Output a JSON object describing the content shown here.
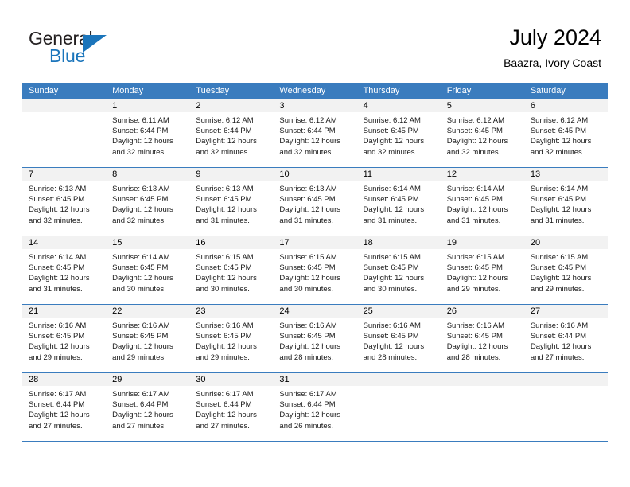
{
  "brand": {
    "word1": "General",
    "word2": "Blue",
    "accent_color": "#1b75bb",
    "logo_icon": "triangle-icon"
  },
  "header": {
    "title": "July 2024",
    "subtitle": "Baazra, Ivory Coast"
  },
  "calendar": {
    "header_bg": "#3a7cbe",
    "daynum_bg": "#f2f2f2",
    "weekday_names": [
      "Sunday",
      "Monday",
      "Tuesday",
      "Wednesday",
      "Thursday",
      "Friday",
      "Saturday"
    ],
    "weeks": [
      [
        null,
        {
          "day": "1",
          "sunrise": "Sunrise: 6:11 AM",
          "sunset": "Sunset: 6:44 PM",
          "daylight_line1": "Daylight: 12 hours",
          "daylight_line2": "and 32 minutes."
        },
        {
          "day": "2",
          "sunrise": "Sunrise: 6:12 AM",
          "sunset": "Sunset: 6:44 PM",
          "daylight_line1": "Daylight: 12 hours",
          "daylight_line2": "and 32 minutes."
        },
        {
          "day": "3",
          "sunrise": "Sunrise: 6:12 AM",
          "sunset": "Sunset: 6:44 PM",
          "daylight_line1": "Daylight: 12 hours",
          "daylight_line2": "and 32 minutes."
        },
        {
          "day": "4",
          "sunrise": "Sunrise: 6:12 AM",
          "sunset": "Sunset: 6:45 PM",
          "daylight_line1": "Daylight: 12 hours",
          "daylight_line2": "and 32 minutes."
        },
        {
          "day": "5",
          "sunrise": "Sunrise: 6:12 AM",
          "sunset": "Sunset: 6:45 PM",
          "daylight_line1": "Daylight: 12 hours",
          "daylight_line2": "and 32 minutes."
        },
        {
          "day": "6",
          "sunrise": "Sunrise: 6:12 AM",
          "sunset": "Sunset: 6:45 PM",
          "daylight_line1": "Daylight: 12 hours",
          "daylight_line2": "and 32 minutes."
        }
      ],
      [
        {
          "day": "7",
          "sunrise": "Sunrise: 6:13 AM",
          "sunset": "Sunset: 6:45 PM",
          "daylight_line1": "Daylight: 12 hours",
          "daylight_line2": "and 32 minutes."
        },
        {
          "day": "8",
          "sunrise": "Sunrise: 6:13 AM",
          "sunset": "Sunset: 6:45 PM",
          "daylight_line1": "Daylight: 12 hours",
          "daylight_line2": "and 32 minutes."
        },
        {
          "day": "9",
          "sunrise": "Sunrise: 6:13 AM",
          "sunset": "Sunset: 6:45 PM",
          "daylight_line1": "Daylight: 12 hours",
          "daylight_line2": "and 31 minutes."
        },
        {
          "day": "10",
          "sunrise": "Sunrise: 6:13 AM",
          "sunset": "Sunset: 6:45 PM",
          "daylight_line1": "Daylight: 12 hours",
          "daylight_line2": "and 31 minutes."
        },
        {
          "day": "11",
          "sunrise": "Sunrise: 6:14 AM",
          "sunset": "Sunset: 6:45 PM",
          "daylight_line1": "Daylight: 12 hours",
          "daylight_line2": "and 31 minutes."
        },
        {
          "day": "12",
          "sunrise": "Sunrise: 6:14 AM",
          "sunset": "Sunset: 6:45 PM",
          "daylight_line1": "Daylight: 12 hours",
          "daylight_line2": "and 31 minutes."
        },
        {
          "day": "13",
          "sunrise": "Sunrise: 6:14 AM",
          "sunset": "Sunset: 6:45 PM",
          "daylight_line1": "Daylight: 12 hours",
          "daylight_line2": "and 31 minutes."
        }
      ],
      [
        {
          "day": "14",
          "sunrise": "Sunrise: 6:14 AM",
          "sunset": "Sunset: 6:45 PM",
          "daylight_line1": "Daylight: 12 hours",
          "daylight_line2": "and 31 minutes."
        },
        {
          "day": "15",
          "sunrise": "Sunrise: 6:14 AM",
          "sunset": "Sunset: 6:45 PM",
          "daylight_line1": "Daylight: 12 hours",
          "daylight_line2": "and 30 minutes."
        },
        {
          "day": "16",
          "sunrise": "Sunrise: 6:15 AM",
          "sunset": "Sunset: 6:45 PM",
          "daylight_line1": "Daylight: 12 hours",
          "daylight_line2": "and 30 minutes."
        },
        {
          "day": "17",
          "sunrise": "Sunrise: 6:15 AM",
          "sunset": "Sunset: 6:45 PM",
          "daylight_line1": "Daylight: 12 hours",
          "daylight_line2": "and 30 minutes."
        },
        {
          "day": "18",
          "sunrise": "Sunrise: 6:15 AM",
          "sunset": "Sunset: 6:45 PM",
          "daylight_line1": "Daylight: 12 hours",
          "daylight_line2": "and 30 minutes."
        },
        {
          "day": "19",
          "sunrise": "Sunrise: 6:15 AM",
          "sunset": "Sunset: 6:45 PM",
          "daylight_line1": "Daylight: 12 hours",
          "daylight_line2": "and 29 minutes."
        },
        {
          "day": "20",
          "sunrise": "Sunrise: 6:15 AM",
          "sunset": "Sunset: 6:45 PM",
          "daylight_line1": "Daylight: 12 hours",
          "daylight_line2": "and 29 minutes."
        }
      ],
      [
        {
          "day": "21",
          "sunrise": "Sunrise: 6:16 AM",
          "sunset": "Sunset: 6:45 PM",
          "daylight_line1": "Daylight: 12 hours",
          "daylight_line2": "and 29 minutes."
        },
        {
          "day": "22",
          "sunrise": "Sunrise: 6:16 AM",
          "sunset": "Sunset: 6:45 PM",
          "daylight_line1": "Daylight: 12 hours",
          "daylight_line2": "and 29 minutes."
        },
        {
          "day": "23",
          "sunrise": "Sunrise: 6:16 AM",
          "sunset": "Sunset: 6:45 PM",
          "daylight_line1": "Daylight: 12 hours",
          "daylight_line2": "and 29 minutes."
        },
        {
          "day": "24",
          "sunrise": "Sunrise: 6:16 AM",
          "sunset": "Sunset: 6:45 PM",
          "daylight_line1": "Daylight: 12 hours",
          "daylight_line2": "and 28 minutes."
        },
        {
          "day": "25",
          "sunrise": "Sunrise: 6:16 AM",
          "sunset": "Sunset: 6:45 PM",
          "daylight_line1": "Daylight: 12 hours",
          "daylight_line2": "and 28 minutes."
        },
        {
          "day": "26",
          "sunrise": "Sunrise: 6:16 AM",
          "sunset": "Sunset: 6:45 PM",
          "daylight_line1": "Daylight: 12 hours",
          "daylight_line2": "and 28 minutes."
        },
        {
          "day": "27",
          "sunrise": "Sunrise: 6:16 AM",
          "sunset": "Sunset: 6:44 PM",
          "daylight_line1": "Daylight: 12 hours",
          "daylight_line2": "and 27 minutes."
        }
      ],
      [
        {
          "day": "28",
          "sunrise": "Sunrise: 6:17 AM",
          "sunset": "Sunset: 6:44 PM",
          "daylight_line1": "Daylight: 12 hours",
          "daylight_line2": "and 27 minutes."
        },
        {
          "day": "29",
          "sunrise": "Sunrise: 6:17 AM",
          "sunset": "Sunset: 6:44 PM",
          "daylight_line1": "Daylight: 12 hours",
          "daylight_line2": "and 27 minutes."
        },
        {
          "day": "30",
          "sunrise": "Sunrise: 6:17 AM",
          "sunset": "Sunset: 6:44 PM",
          "daylight_line1": "Daylight: 12 hours",
          "daylight_line2": "and 27 minutes."
        },
        {
          "day": "31",
          "sunrise": "Sunrise: 6:17 AM",
          "sunset": "Sunset: 6:44 PM",
          "daylight_line1": "Daylight: 12 hours",
          "daylight_line2": "and 26 minutes."
        },
        null,
        null,
        null
      ]
    ]
  }
}
